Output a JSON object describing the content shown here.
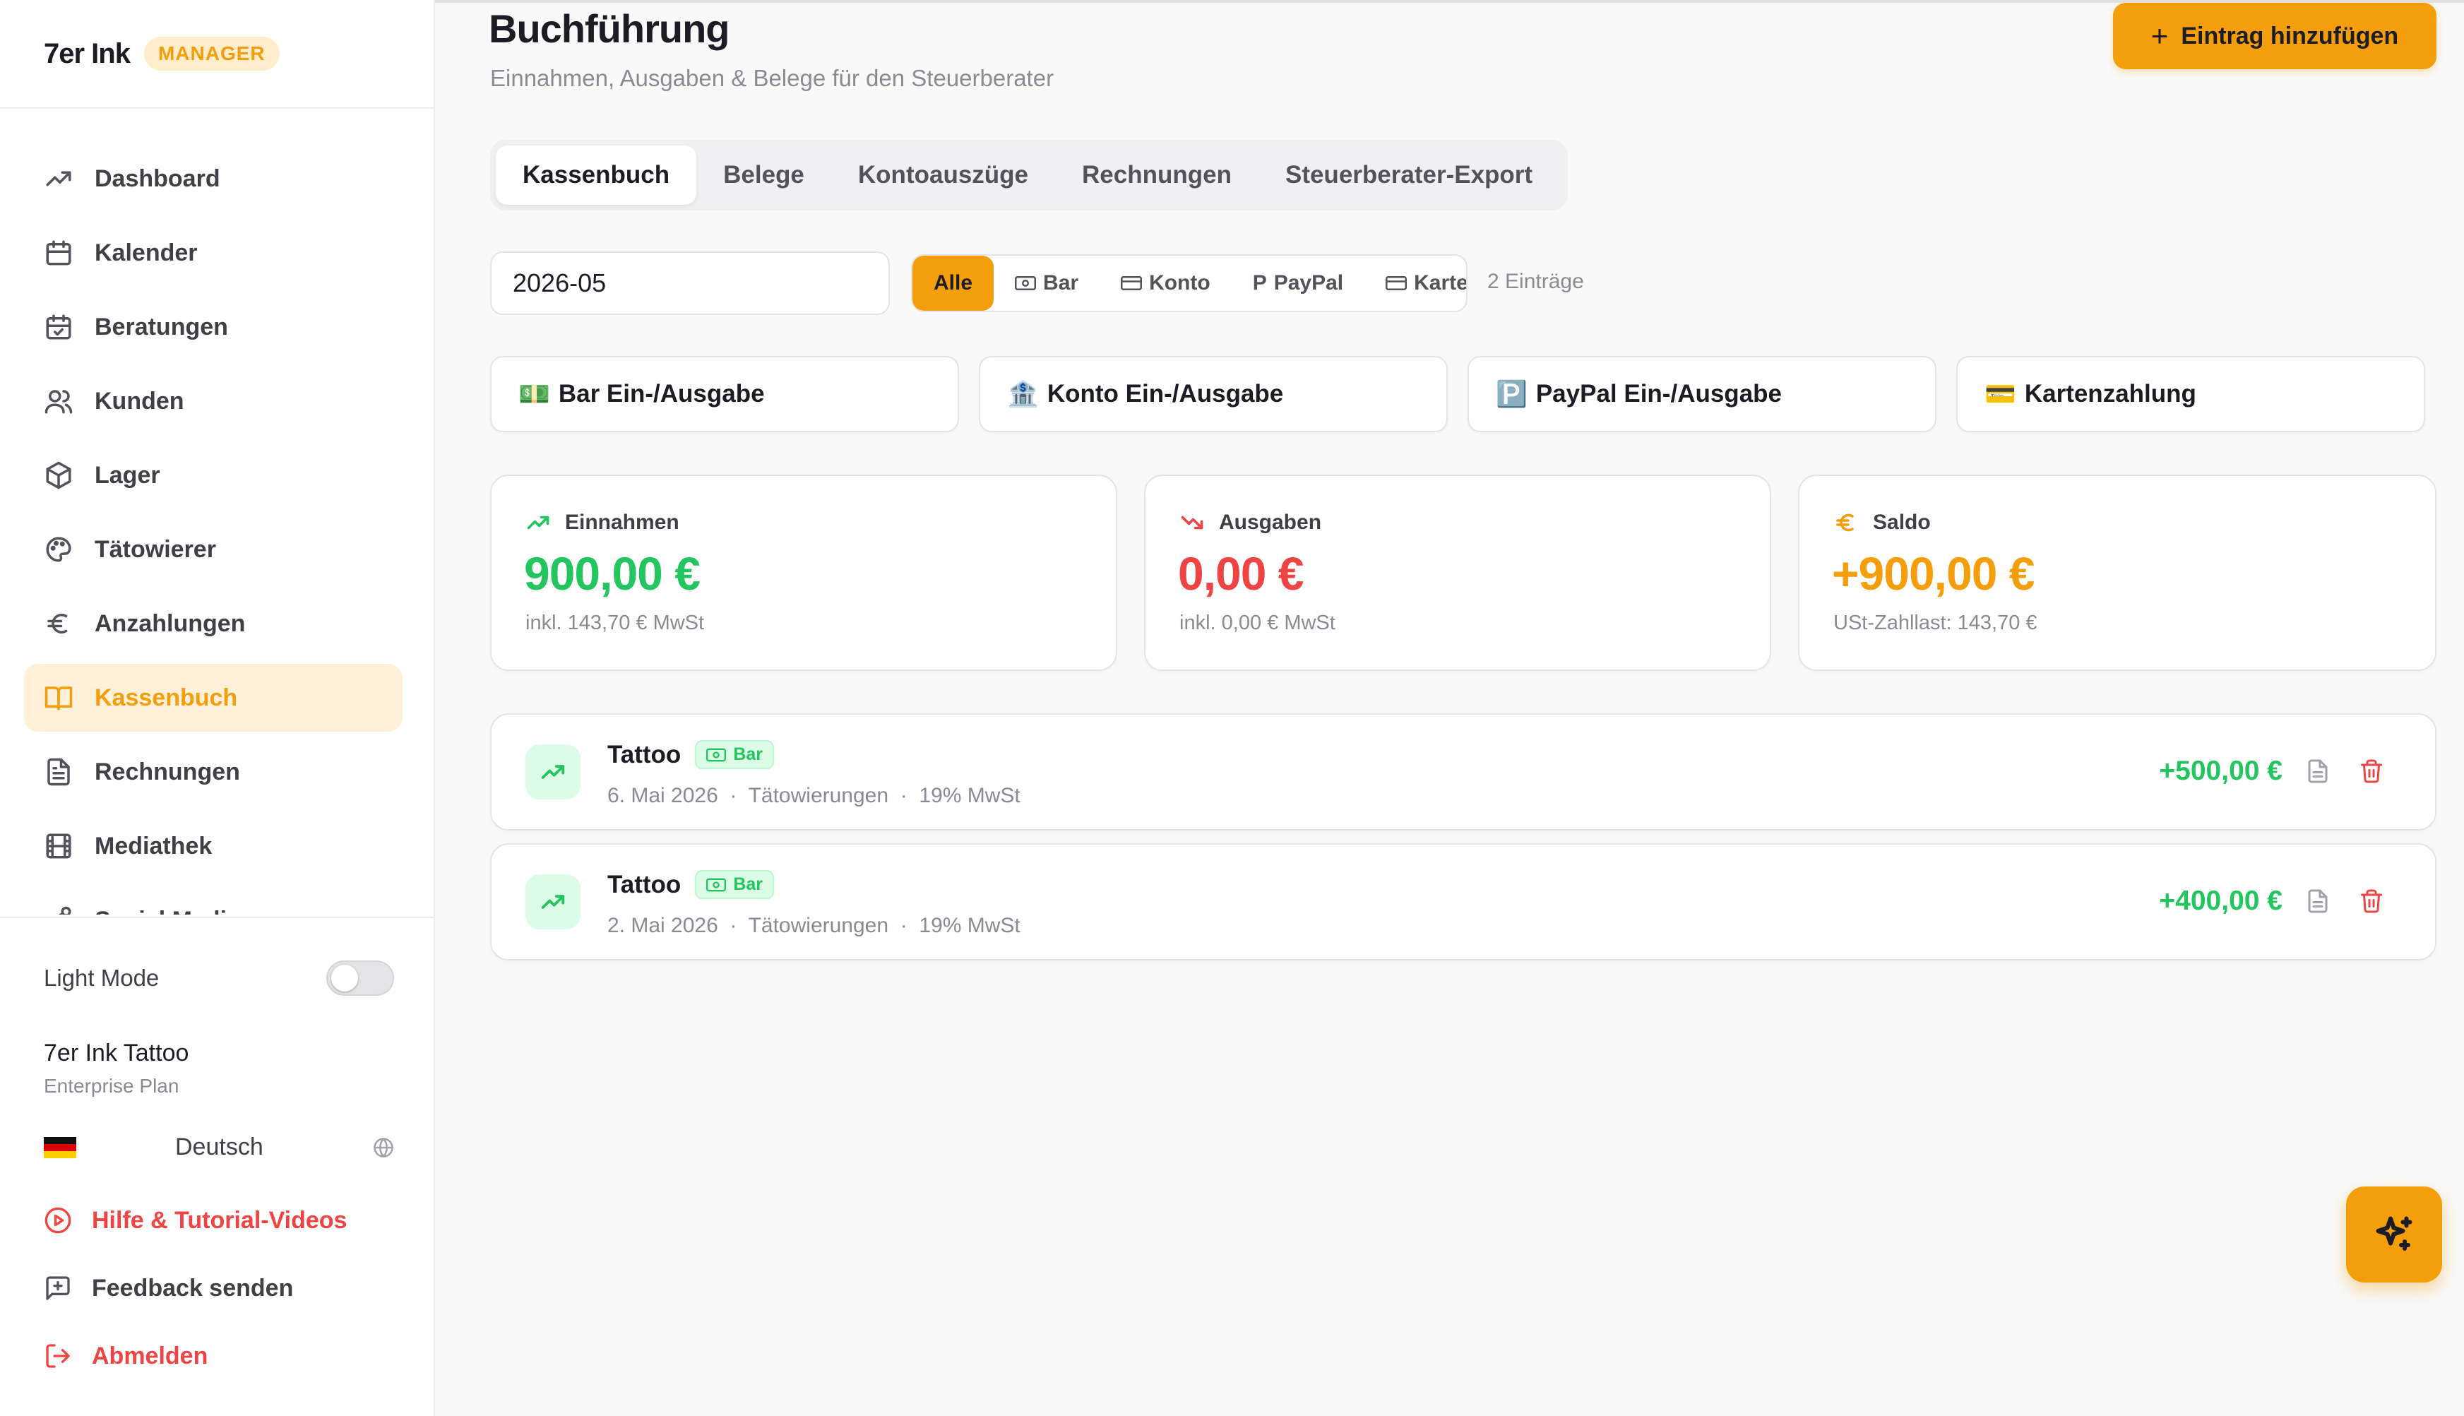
{
  "brand": {
    "name": "7er Ink",
    "badge": "MANAGER"
  },
  "sidebar": {
    "items": [
      {
        "label": "Dashboard",
        "icon": "trending-up-icon"
      },
      {
        "label": "Kalender",
        "icon": "calendar-icon"
      },
      {
        "label": "Beratungen",
        "icon": "calendar-check-icon"
      },
      {
        "label": "Kunden",
        "icon": "users-icon"
      },
      {
        "label": "Lager",
        "icon": "package-icon"
      },
      {
        "label": "Tätowierer",
        "icon": "palette-icon"
      },
      {
        "label": "Anzahlungen",
        "icon": "euro-icon"
      },
      {
        "label": "Kassenbuch",
        "icon": "book-open-icon",
        "active": true
      },
      {
        "label": "Rechnungen",
        "icon": "file-text-icon"
      },
      {
        "label": "Mediathek",
        "icon": "film-icon"
      },
      {
        "label": "Social Media",
        "icon": "share-icon"
      }
    ],
    "light_mode_label": "Light Mode",
    "org_name": "7er Ink Tattoo",
    "org_plan": "Enterprise Plan",
    "language": "Deutsch",
    "help_label": "Hilfe & Tutorial-Videos",
    "feedback_label": "Feedback senden",
    "logout_label": "Abmelden"
  },
  "header": {
    "title": "Buchführung",
    "subtitle": "Einnahmen, Ausgaben & Belege für den Steuerberater",
    "add_button": "Eintrag hinzufügen"
  },
  "tabs": [
    "Kassenbuch",
    "Belege",
    "Kontoauszüge",
    "Rechnungen",
    "Steuerberater-Export"
  ],
  "active_tab": "Kassenbuch",
  "month_filter": {
    "value": "2026-05"
  },
  "payment_filters": [
    "Alle",
    "Bar",
    "Konto",
    "PayPal",
    "Karte"
  ],
  "active_filter": "Alle",
  "entry_count": "2 Einträge",
  "quick_actions": [
    {
      "emoji": "💵",
      "label": "Bar Ein-/Ausgabe"
    },
    {
      "emoji": "🏦",
      "label": "Konto Ein-/Ausgabe"
    },
    {
      "emoji": "🅿️",
      "label": "PayPal Ein-/Ausgabe"
    },
    {
      "emoji": "💳",
      "label": "Kartenzahlung"
    }
  ],
  "stats": {
    "income": {
      "label": "Einnahmen",
      "value": "900,00 €",
      "note": "inkl. 143,70 € MwSt"
    },
    "expenses": {
      "label": "Ausgaben",
      "value": "0,00 €",
      "note": "inkl. 0,00 € MwSt"
    },
    "balance": {
      "label": "Saldo",
      "value": "+900,00 €",
      "note": "USt-Zahllast: 143,70 €"
    }
  },
  "entries": [
    {
      "title": "Tattoo",
      "method": "Bar",
      "date": "6. Mai 2026",
      "category": "Tätowierungen",
      "vat": "19% MwSt",
      "amount": "+500,00 €"
    },
    {
      "title": "Tattoo",
      "method": "Bar",
      "date": "2. Mai 2026",
      "category": "Tätowierungen",
      "vat": "19% MwSt",
      "amount": "+400,00 €"
    }
  ],
  "colors": {
    "accent": "#f59e0b",
    "income": "#22c55e",
    "expense": "#ef4444",
    "balance": "#f59e0b"
  }
}
